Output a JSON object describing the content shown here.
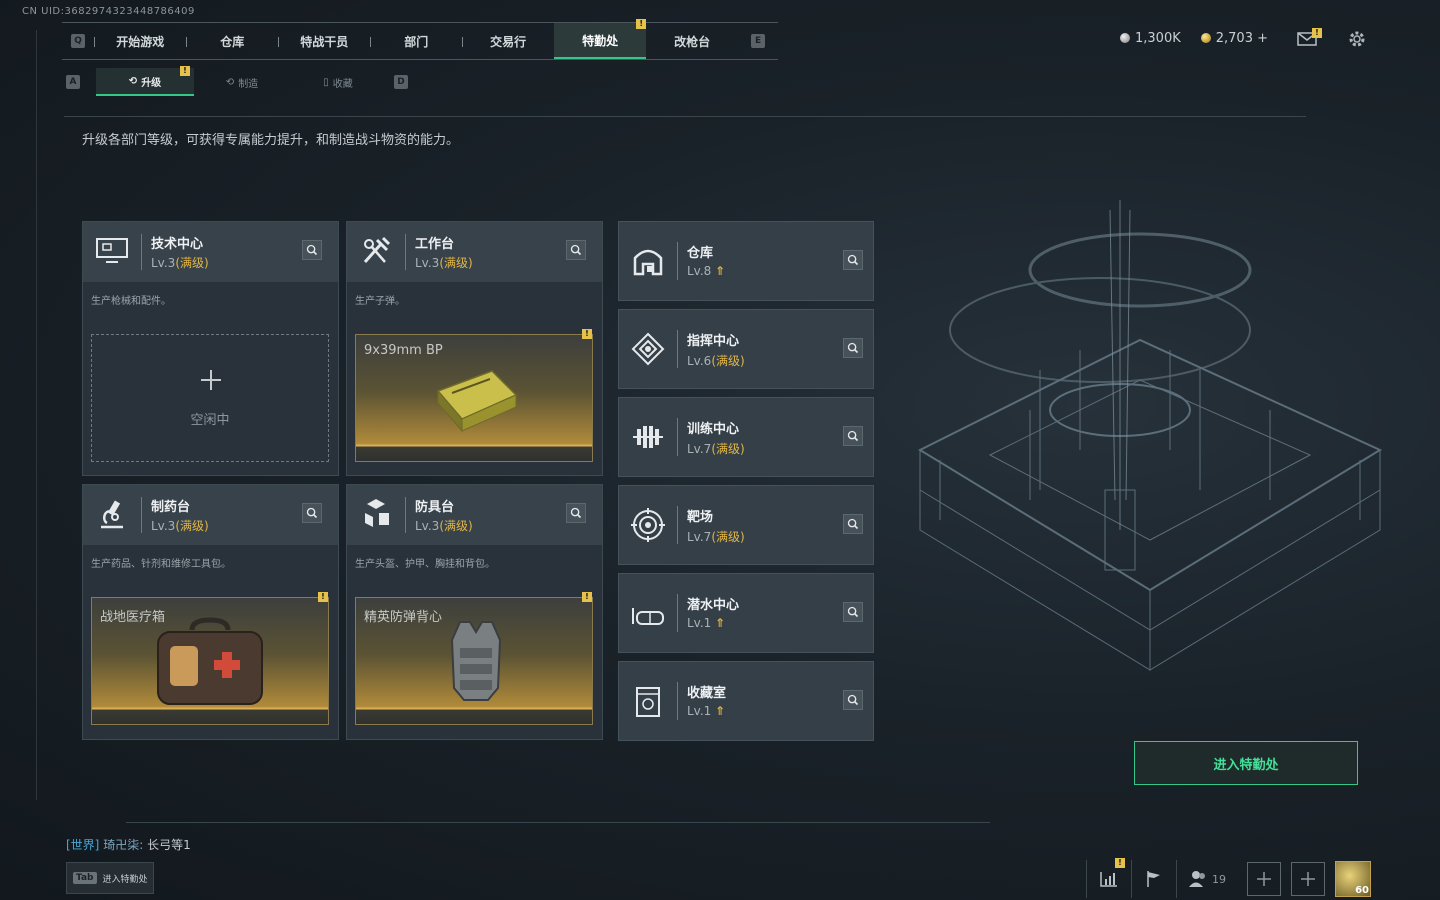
{
  "uid": "CN UID:3682974323448786409",
  "topnav": {
    "left_key": "Q",
    "right_key": "E",
    "tabs": [
      {
        "label": "开始游戏"
      },
      {
        "label": "仓库"
      },
      {
        "label": "特战干员"
      },
      {
        "label": "部门"
      },
      {
        "label": "交易行"
      },
      {
        "label": "特勤处",
        "active": true,
        "alert": "!"
      },
      {
        "label": "改枪台"
      }
    ]
  },
  "currency": {
    "silver": "1,300K",
    "gold": "2,703 +"
  },
  "subtabs": {
    "left_key": "A",
    "right_key": "D",
    "items": [
      {
        "label": "升级",
        "active": true,
        "alert": "!"
      },
      {
        "label": "制造"
      },
      {
        "label": "收藏"
      }
    ]
  },
  "description": "升级各部门等级，可获得专属能力提升，和制造战斗物资的能力。",
  "departments": [
    {
      "title": "技术中心",
      "level": "Lv.3",
      "status": "(满级)",
      "desc": "生产枪械和配件。",
      "slot": {
        "empty": true,
        "text": "空闲中"
      }
    },
    {
      "title": "工作台",
      "level": "Lv.3",
      "status": "(满级)",
      "desc": "生产子弹。",
      "slot": {
        "empty": false,
        "item": "9x39mm BP",
        "alert": "!"
      }
    },
    {
      "title": "制药台",
      "level": "Lv.3",
      "status": "(满级)",
      "desc": "生产药品、针剂和维修工具包。",
      "slot": {
        "empty": false,
        "item": "战地医疗箱",
        "alert": "!"
      }
    },
    {
      "title": "防具台",
      "level": "Lv.3",
      "status": "(满级)",
      "desc": "生产头盔、护甲、胸挂和背包。",
      "slot": {
        "empty": false,
        "item": "精英防弹背心",
        "alert": "!"
      }
    }
  ],
  "facilities": [
    {
      "title": "仓库",
      "level": "Lv.8",
      "status": "",
      "upgradable": true,
      "icon": "warehouse-icon"
    },
    {
      "title": "指挥中心",
      "level": "Lv.6",
      "status": "(满级)",
      "upgradable": false,
      "icon": "command-icon"
    },
    {
      "title": "训练中心",
      "level": "Lv.7",
      "status": "(满级)",
      "upgradable": false,
      "icon": "dumbbell-icon"
    },
    {
      "title": "靶场",
      "level": "Lv.7",
      "status": "(满级)",
      "upgradable": false,
      "icon": "target-icon"
    },
    {
      "title": "潜水中心",
      "level": "Lv.1",
      "status": "",
      "upgradable": true,
      "icon": "diving-mask-icon"
    },
    {
      "title": "收藏室",
      "level": "Lv.1",
      "status": "",
      "upgradable": true,
      "icon": "collection-icon"
    }
  ],
  "enter_button": "进入特勤处",
  "chat": {
    "channel": "[世界]",
    "user": "琦卍柒:",
    "message": "长弓等1"
  },
  "tab_hint": {
    "key": "Tab",
    "label": "进入特勤处"
  },
  "bottom": {
    "friends_count": "19",
    "player_level": "60"
  },
  "colors": {
    "accent_green": "#35c78a",
    "max_level_gold": "#e0b648",
    "alert_yellow": "#e7c24a"
  }
}
